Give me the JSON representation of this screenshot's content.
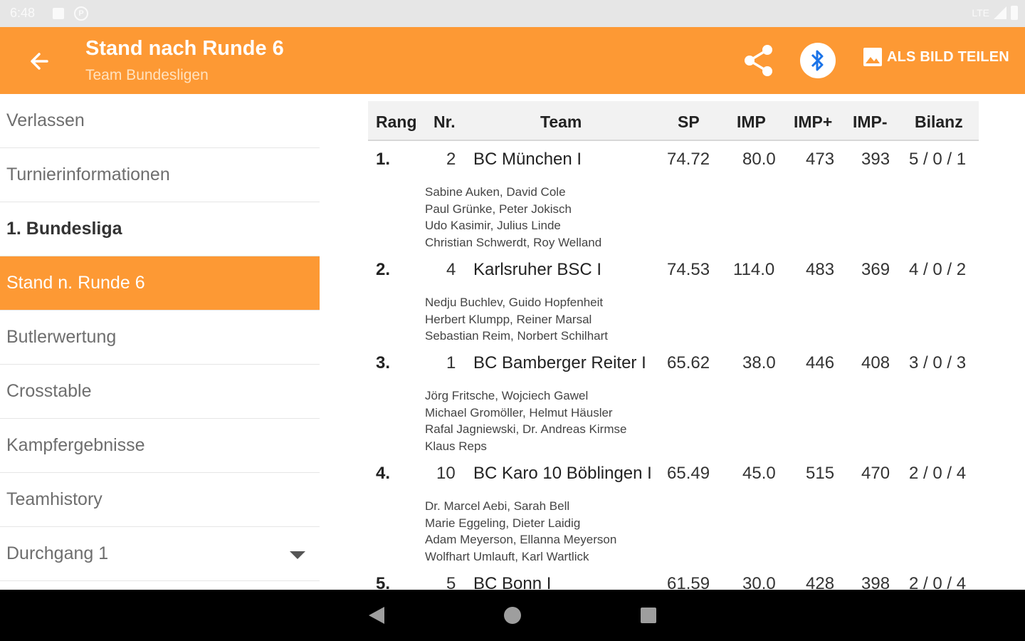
{
  "status": {
    "time": "6:48",
    "network": "LTE"
  },
  "appbar": {
    "title": "Stand nach Runde 6",
    "subtitle": "Team Bundesligen",
    "share_image_label": "ALS BILD TEILEN",
    "icons": [
      "back-arrow-icon",
      "share-icon",
      "bluetooth-icon",
      "image-icon"
    ]
  },
  "sidebar": {
    "items": [
      {
        "label": "Verlassen"
      },
      {
        "label": "Turnierinformationen"
      },
      {
        "label": "1. Bundesliga"
      },
      {
        "label": "Stand n. Runde 6"
      },
      {
        "label": "Butlerwertung"
      },
      {
        "label": "Crosstable"
      },
      {
        "label": "Kampfergebnisse"
      },
      {
        "label": "Teamhistory"
      },
      {
        "label": "Durchgang 1"
      }
    ]
  },
  "table": {
    "headers": [
      "Rang",
      "Nr.",
      "Team",
      "SP",
      "IMP",
      "IMP+",
      "IMP-",
      "Bilanz"
    ],
    "rows": [
      {
        "rank": "1.",
        "nr": "2",
        "team": "BC München I",
        "sp": "74.72",
        "imp": "80.0",
        "imp_plus": "473",
        "imp_minus": "393",
        "bilanz": "5 / 0 / 1",
        "players": [
          "Sabine Auken, David Cole",
          "Paul Grünke, Peter Jokisch",
          "Udo Kasimir, Julius Linde",
          "Christian Schwerdt, Roy Welland"
        ]
      },
      {
        "rank": "2.",
        "nr": "4",
        "team": "Karlsruher BSC I",
        "sp": "74.53",
        "imp": "114.0",
        "imp_plus": "483",
        "imp_minus": "369",
        "bilanz": "4 / 0 / 2",
        "players": [
          "Nedju Buchlev, Guido Hopfenheit",
          "Herbert Klumpp, Reiner Marsal",
          "Sebastian Reim, Norbert Schilhart"
        ]
      },
      {
        "rank": "3.",
        "nr": "1",
        "team": "BC Bamberger Reiter I",
        "sp": "65.62",
        "imp": "38.0",
        "imp_plus": "446",
        "imp_minus": "408",
        "bilanz": "3 / 0 / 3",
        "players": [
          "Jörg Fritsche, Wojciech Gawel",
          "Michael Gromöller, Helmut Häusler",
          "Rafal Jagniewski, Dr. Andreas Kirmse",
          "Klaus Reps"
        ]
      },
      {
        "rank": "4.",
        "nr": "10",
        "team": "BC Karo 10 Böblingen I",
        "sp": "65.49",
        "imp": "45.0",
        "imp_plus": "515",
        "imp_minus": "470",
        "bilanz": "2 / 0 / 4",
        "players": [
          "Dr. Marcel Aebi, Sarah Bell",
          "Marie Eggeling, Dieter Laidig",
          "Adam Meyerson, Ellanna Meyerson",
          "Wolfhart Umlauft, Karl Wartlick"
        ]
      },
      {
        "rank": "5.",
        "nr": "5",
        "team": "BC Bonn I",
        "sp": "61.59",
        "imp": "30.0",
        "imp_plus": "428",
        "imp_minus": "398",
        "bilanz": "2 / 0 / 4",
        "players": []
      }
    ]
  },
  "colors": {
    "accent": "#fd9934",
    "bluetooth": "#1a73e8"
  }
}
